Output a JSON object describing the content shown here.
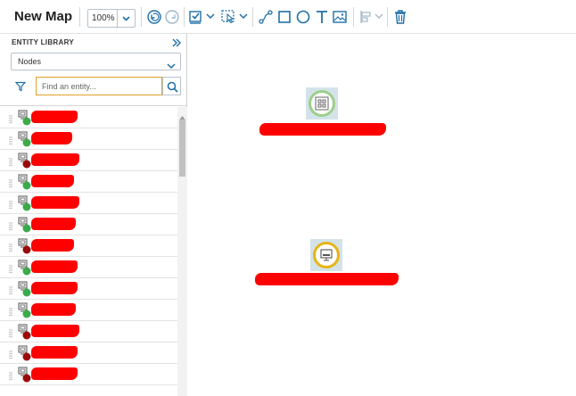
{
  "toolbar": {
    "title": "New Map",
    "zoom_value": "100%",
    "icons": [
      "undo-icon",
      "redo-icon",
      "checklist-icon",
      "node-select-icon",
      "connector-icon",
      "rectangle-icon",
      "circle-icon",
      "text-icon",
      "image-icon",
      "align-icon",
      "delete-icon"
    ]
  },
  "sidebar": {
    "title": "ENTITY LIBRARY",
    "entity_type": "Nodes",
    "search_placeholder": "Find an entity...",
    "items": [
      {
        "label": "[redacted]",
        "status": "up"
      },
      {
        "label": "[redacted]",
        "status": "up"
      },
      {
        "label": "[redacted]",
        "status": "down"
      },
      {
        "label": "[redacted]",
        "status": "up"
      },
      {
        "label": "[redacted]",
        "status": "up"
      },
      {
        "label": "[redacted]",
        "status": "up"
      },
      {
        "label": "[redacted]",
        "status": "down"
      },
      {
        "label": "[redacted]",
        "status": "up"
      },
      {
        "label": "[redacted]",
        "status": "up"
      },
      {
        "label": "[redacted]",
        "status": "up"
      },
      {
        "label": "[redacted]",
        "status": "down"
      },
      {
        "label": "[redacted]",
        "status": "down"
      },
      {
        "label": "[redacted]",
        "status": "down"
      }
    ]
  },
  "canvas": {
    "nodes": [
      {
        "label": "[redacted]",
        "ring_color": "#9ccf8a",
        "icon": "group-icon"
      },
      {
        "label": "[redacted]",
        "ring_color": "#e7b416",
        "icon": "monitor-icon"
      }
    ]
  },
  "colors": {
    "accent": "#1f6fa8",
    "status_up": "#3aaa4a",
    "status_down": "#9b0a0a",
    "redaction": "#ff0000"
  }
}
